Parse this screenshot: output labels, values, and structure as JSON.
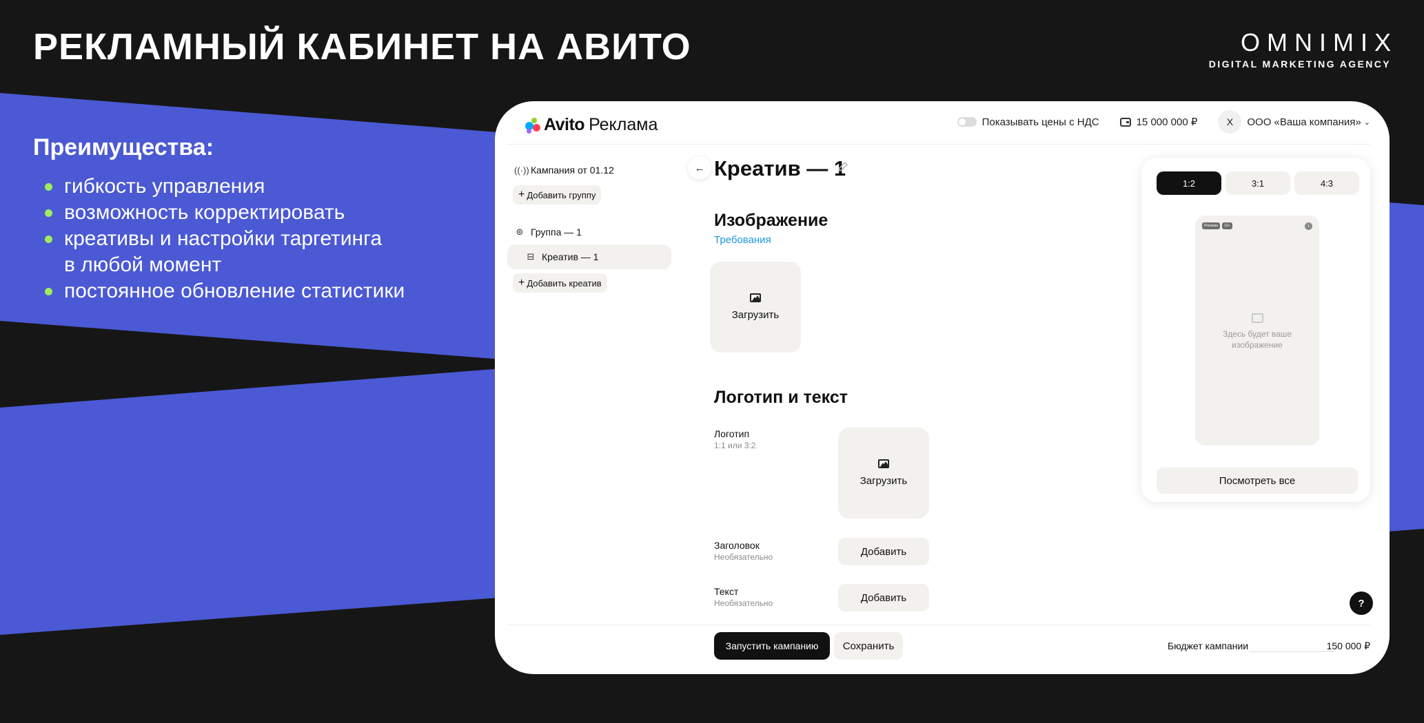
{
  "slide": {
    "title": "РЕКЛАМНЫЙ КАБИНЕТ НА АВИТО",
    "brand_name": "OMNIMIX",
    "brand_tagline": "DIGITAL MARKETING AGENCY",
    "colors": {
      "background": "#161616",
      "accent_blue": "#4b59d4",
      "bullet_green": "#9fec5c"
    }
  },
  "benefits": {
    "title": "Преимущества:",
    "items": [
      "гибкость управления",
      "возможность корректировать",
      "креативы и настройки таргетинга",
      "в любой момент",
      "постоянное обновление статистики"
    ]
  },
  "app": {
    "logo_word": "Avito",
    "logo_suffix": "Реклама",
    "header": {
      "vat_toggle_label": "Показывать цены с НДС",
      "balance": "15 000 000 ₽",
      "avatar_letter": "Х",
      "company": "ООО «Ваша компания»"
    },
    "sidebar": {
      "campaign": "Кампания от 01.12",
      "add_group": "Добавить группу",
      "group": "Группа — 1",
      "creative": "Креатив — 1",
      "add_creative": "Добавить креатив"
    },
    "editor": {
      "title": "Креатив — 1",
      "image_section": "Изображение",
      "requirements_link": "Требования",
      "upload_label": "Загрузить",
      "logo_text_section": "Логотип и текст",
      "logo_label": "Логотип",
      "logo_hint": "1:1 или 3:2",
      "logo_upload_label": "Загрузить",
      "headline_label": "Заголовок",
      "headline_hint": "Необязательно",
      "headline_add": "Добавить",
      "text_label": "Текст",
      "text_hint": "Необязательно",
      "text_add": "Добавить"
    },
    "preview": {
      "ratios": [
        "1:2",
        "3:1",
        "4:3"
      ],
      "badges": [
        "Реклама",
        "12+"
      ],
      "placeholder": "Здесь будет ваше изображение",
      "view_all": "Посмотреть все"
    },
    "footer": {
      "launch": "Запустить кампанию",
      "save": "Сохранить",
      "budget_label": "Бюджет кампании",
      "budget_value": "150 000 ₽"
    }
  }
}
